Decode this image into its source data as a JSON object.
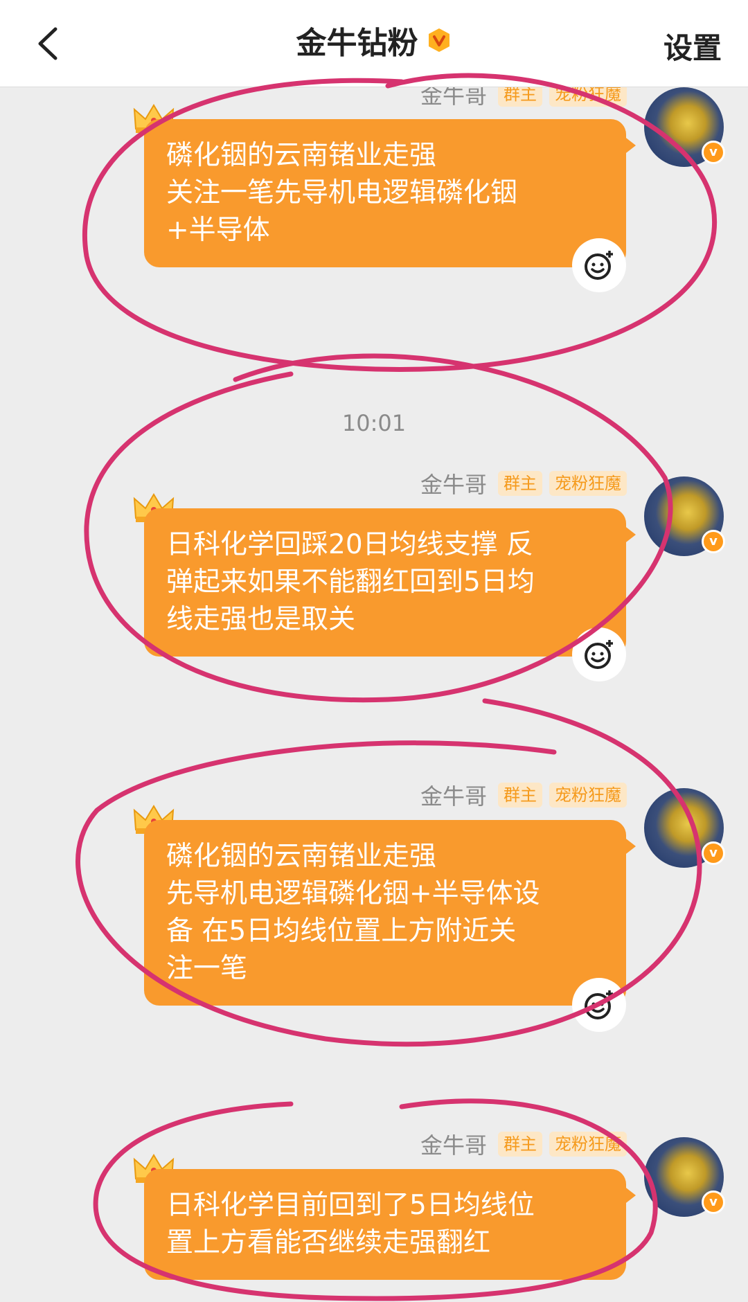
{
  "header": {
    "title": "金牛钻粉",
    "settings_label": "设置"
  },
  "timestamp": "10:01",
  "messages": [
    {
      "sender": "金牛哥",
      "role_badge": "群主",
      "fan_badge": "宠粉狂魔",
      "text": "磷化铟的云南锗业走强\n关注一笔先导机电逻辑磷化铟\n+半导体"
    },
    {
      "sender": "金牛哥",
      "role_badge": "群主",
      "fan_badge": "宠粉狂魔",
      "text": "日科化学回踩20日均线支撑 反\n弹起来如果不能翻红回到5日均\n线走强也是取关"
    },
    {
      "sender": "金牛哥",
      "role_badge": "群主",
      "fan_badge": "宠粉狂魔",
      "text": "磷化铟的云南锗业走强\n先导机电逻辑磷化铟+半导体设\n备 在5日均线位置上方附近关\n注一笔"
    },
    {
      "sender": "金牛哥",
      "role_badge": "群主",
      "fan_badge": "宠粉狂魔",
      "text": "日科化学目前回到了5日均线位\n置上方看能否继续走强翻红"
    }
  ],
  "colors": {
    "bubble": "#f99a2d",
    "badge_text": "#f59a1c",
    "annotation": "#d6336f"
  }
}
